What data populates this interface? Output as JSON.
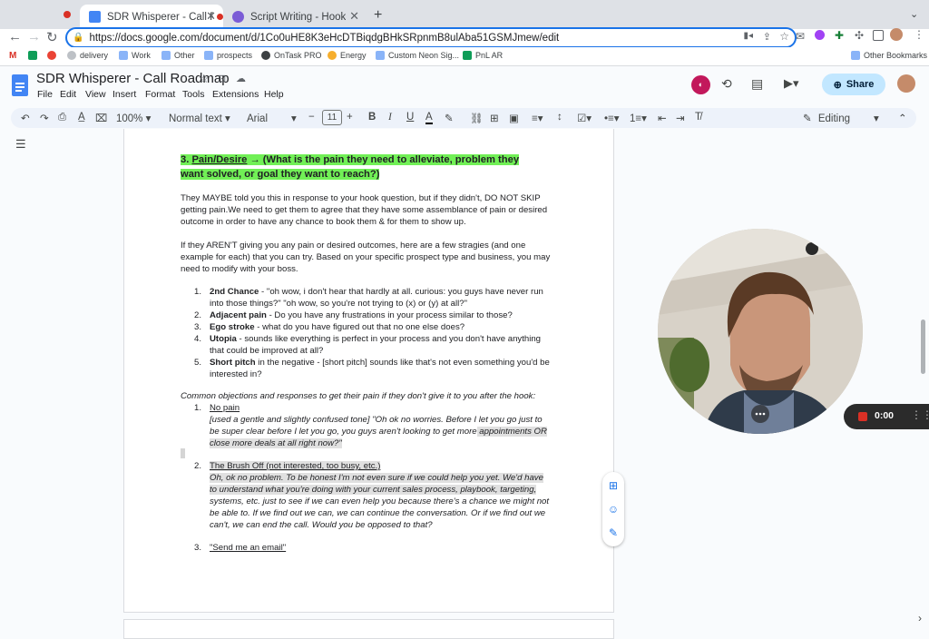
{
  "browser": {
    "tabs": [
      {
        "title": "SDR Whisperer - Call Roadm",
        "active": true,
        "recording": true
      },
      {
        "title": "Script Writing - Hook",
        "active": false
      }
    ],
    "url": "https://docs.google.com/document/d/1Co0uHE8K3eHcDTBiqdgBHkSRpnmB8ulAba51GSMJmew/edit",
    "bookmarks": [
      {
        "label": "delivery"
      },
      {
        "label": "Work"
      },
      {
        "label": "Other"
      },
      {
        "label": "prospects"
      },
      {
        "label": "OnTask PRO"
      },
      {
        "label": "Energy"
      },
      {
        "label": "Custom Neon Sig..."
      },
      {
        "label": "PnL AR"
      }
    ],
    "other_bookmarks": "Other Bookmarks"
  },
  "doc": {
    "title": "SDR Whisperer - Call Roadmap",
    "menus": [
      "File",
      "Edit",
      "View",
      "Insert",
      "Format",
      "Tools",
      "Extensions",
      "Help"
    ],
    "share_label": "Share",
    "toolbar": {
      "zoom": "100%",
      "style": "Normal text",
      "font": "Arial",
      "font_size": "11",
      "mode": "Editing"
    },
    "content": {
      "heading_num": "3. ",
      "heading_u": "Pain/Desire",
      "heading_rest": " → (What is the pain they need to alleviate, problem they",
      "heading_line2": "want solved, or goal they want to reach?)",
      "para1_l1": "They MAYBE told you this in response to your hook question, but if they didn't, DO NOT SKIP",
      "para1_l2": "getting pain.We need to get them to agree that they have some assemblance of pain or desired",
      "para1_l3": "outcome in order to have any chance to book them & for them to show up.",
      "para2_l1": "If they AREN'T giving you any pain or desired outcomes, here are a few stragies (and one",
      "para2_l2": "example for each) that you can try. Based on your specific prospect type and business, you may",
      "para2_l3": "need to modify with your boss.",
      "strategies": [
        {
          "num": "1.",
          "bold": "2nd Chance",
          "l1": " - \"oh wow, i don't hear that hardly at all. curious: you guys have never run",
          "l2": "into those things?\" \"oh wow, so you're not trying to (x) or (y) at all?\""
        },
        {
          "num": "2.",
          "bold": "Adjacent pain",
          "l1": " - Do you have any frustrations in your process similar to those?",
          "l2": ""
        },
        {
          "num": "3.",
          "bold": "Ego stroke",
          "l1": " - what do you have figured out that no one else does?",
          "l2": ""
        },
        {
          "num": "4.",
          "bold": "Utopia",
          "l1": " - sounds like everything is perfect in your process and you don't have anything",
          "l2": "that could be improved at all?"
        },
        {
          "num": "5.",
          "bold": "Short pitch",
          "l1": " in the negative - [short pitch] sounds like that's not even something you'd be",
          "l2": "interested in?"
        }
      ],
      "objections_intro": "Common objections and responses to get their pain if they don't give it to you after the hook:",
      "obj1_num": "1.",
      "obj1_title": "No pain",
      "obj1_l1": "[used a gentle and slightly confused tone] \"Oh ok no worries. Before I let you go just to",
      "obj1_l2a": "be super clear before I let you go, you guys aren't looking to get more",
      "obj1_l2b": " appointments OR",
      "obj1_l3": "close more deals at all right now?\"",
      "obj2_num": "2.",
      "obj2_title": "The Brush Off (not interested, too busy, etc.)",
      "obj2_l1": "Oh, ok no problem. To be honest I'm not even sure if we could help you yet. We'd have",
      "obj2_l2": "to understand what you're doing with your current sales process, playbook, targeting,",
      "obj2_l3": "systems, etc. just to see if we can even help you because there's a chance we might not",
      "obj2_l4": "be able to. If we find out we can, we can continue the conversation. Or if we find out we",
      "obj2_l5": "can't, we can end the call. Would you be opposed to that?",
      "obj3_num": "3.",
      "obj3_title": "\"Send me an email\""
    }
  },
  "recorder": {
    "time": "0:00"
  },
  "colors": {
    "highlight": "#71f056",
    "accent": "#1a73e8",
    "rec": "#d93025"
  }
}
